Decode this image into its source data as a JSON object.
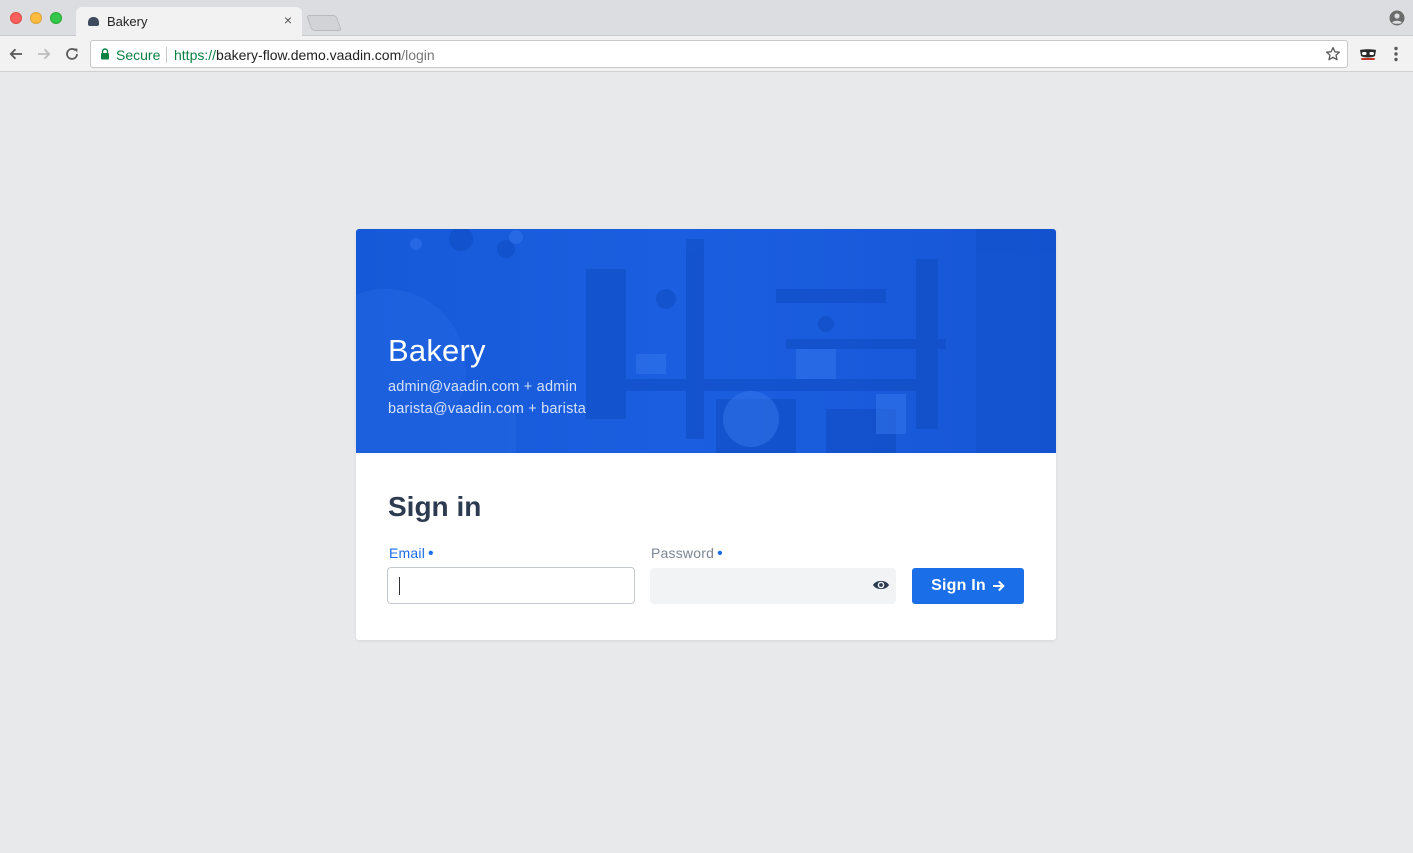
{
  "browser": {
    "tab": {
      "title": "Bakery",
      "close_glyph": "×"
    },
    "address_bar": {
      "secure_label": "Secure",
      "url_scheme": "https://",
      "url_host": "bakery-flow.demo.vaadin.com",
      "url_path": "/login"
    },
    "icons": [
      "back-icon",
      "forward-icon",
      "reload-icon",
      "lock-icon",
      "star-icon",
      "extension-icon",
      "menu-icon",
      "profile-icon"
    ]
  },
  "hero": {
    "title": "Bakery",
    "credentials": [
      "admin@vaadin.com + admin",
      "barista@vaadin.com + barista"
    ],
    "color": "#1659d8"
  },
  "form": {
    "title": "Sign in",
    "email": {
      "label": "Email",
      "value": "",
      "required": true
    },
    "password": {
      "label": "Password",
      "value": "",
      "required": true
    },
    "required_glyph": "•",
    "submit_label": "Sign In"
  },
  "colors": {
    "accent": "#1a6ee8",
    "page_background": "#e8e9eb",
    "heading": "#2d3b50"
  }
}
